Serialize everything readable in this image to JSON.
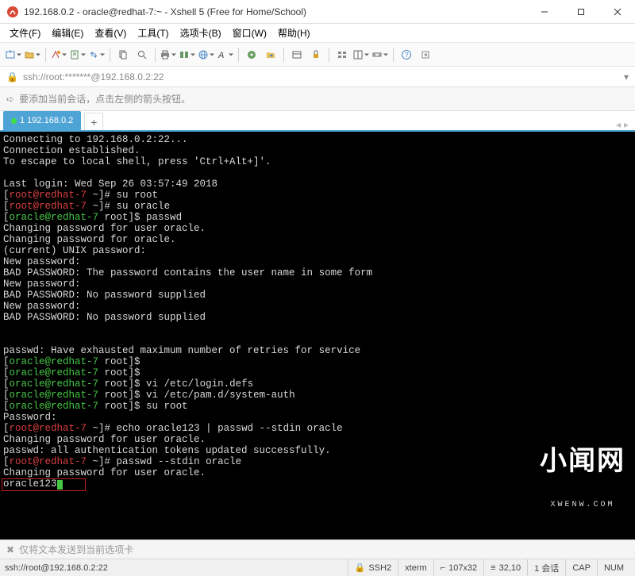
{
  "window": {
    "title": "192.168.0.2 - oracle@redhat-7:~ - Xshell 5 (Free for Home/School)"
  },
  "menu": {
    "file": "文件(F)",
    "edit": "编辑(E)",
    "view": "查看(V)",
    "tools": "工具(T)",
    "tab": "选项卡(B)",
    "window": "窗口(W)",
    "help": "帮助(H)"
  },
  "address": {
    "url": "ssh://root:*******@192.168.0.2:22"
  },
  "infobar": {
    "text": "要添加当前会话，点击左侧的箭头按钮。"
  },
  "tabs": [
    {
      "label": "1 192.168.0.2"
    }
  ],
  "terminal": {
    "lines": [
      {
        "segs": [
          {
            "c": "w",
            "t": "Connecting to 192.168.0.2:22..."
          }
        ]
      },
      {
        "segs": [
          {
            "c": "w",
            "t": "Connection established."
          }
        ]
      },
      {
        "segs": [
          {
            "c": "w",
            "t": "To escape to local shell, press 'Ctrl+Alt+]'."
          }
        ]
      },
      {
        "segs": []
      },
      {
        "segs": [
          {
            "c": "w",
            "t": "Last login: Wed Sep 26 03:57:49 2018"
          }
        ]
      },
      {
        "segs": [
          {
            "c": "w",
            "t": "["
          },
          {
            "c": "r",
            "t": "root@redhat-7"
          },
          {
            "c": "w",
            "t": " ~]# su root"
          }
        ]
      },
      {
        "segs": [
          {
            "c": "w",
            "t": "["
          },
          {
            "c": "r",
            "t": "root@redhat-7"
          },
          {
            "c": "w",
            "t": " ~]# su oracle"
          }
        ]
      },
      {
        "segs": [
          {
            "c": "w",
            "t": "["
          },
          {
            "c": "g",
            "t": "oracle@redhat-7"
          },
          {
            "c": "w",
            "t": " root]$ passwd"
          }
        ]
      },
      {
        "segs": [
          {
            "c": "w",
            "t": "Changing password for user oracle."
          }
        ]
      },
      {
        "segs": [
          {
            "c": "w",
            "t": "Changing password for oracle."
          }
        ]
      },
      {
        "segs": [
          {
            "c": "w",
            "t": "(current) UNIX password:"
          }
        ]
      },
      {
        "segs": [
          {
            "c": "w",
            "t": "New password:"
          }
        ]
      },
      {
        "segs": [
          {
            "c": "w",
            "t": "BAD PASSWORD: The password contains the user name in some form"
          }
        ]
      },
      {
        "segs": [
          {
            "c": "w",
            "t": "New password:"
          }
        ]
      },
      {
        "segs": [
          {
            "c": "w",
            "t": "BAD PASSWORD: No password supplied"
          }
        ]
      },
      {
        "segs": [
          {
            "c": "w",
            "t": "New password:"
          }
        ]
      },
      {
        "segs": [
          {
            "c": "w",
            "t": "BAD PASSWORD: No password supplied"
          }
        ]
      },
      {
        "segs": []
      },
      {
        "segs": []
      },
      {
        "segs": [
          {
            "c": "w",
            "t": "passwd: Have exhausted maximum number of retries for service"
          }
        ]
      },
      {
        "segs": [
          {
            "c": "w",
            "t": "["
          },
          {
            "c": "g",
            "t": "oracle@redhat-7"
          },
          {
            "c": "w",
            "t": " root]$"
          }
        ]
      },
      {
        "segs": [
          {
            "c": "w",
            "t": "["
          },
          {
            "c": "g",
            "t": "oracle@redhat-7"
          },
          {
            "c": "w",
            "t": " root]$"
          }
        ]
      },
      {
        "segs": [
          {
            "c": "w",
            "t": "["
          },
          {
            "c": "g",
            "t": "oracle@redhat-7"
          },
          {
            "c": "w",
            "t": " root]$ vi /etc/login.defs"
          }
        ]
      },
      {
        "segs": [
          {
            "c": "w",
            "t": "["
          },
          {
            "c": "g",
            "t": "oracle@redhat-7"
          },
          {
            "c": "w",
            "t": " root]$ vi /etc/pam.d/system-auth"
          }
        ]
      },
      {
        "segs": [
          {
            "c": "w",
            "t": "["
          },
          {
            "c": "g",
            "t": "oracle@redhat-7"
          },
          {
            "c": "w",
            "t": " root]$ su root"
          }
        ]
      },
      {
        "segs": [
          {
            "c": "w",
            "t": "Password:"
          }
        ]
      },
      {
        "segs": [
          {
            "c": "w",
            "t": "["
          },
          {
            "c": "r",
            "t": "root@redhat-7"
          },
          {
            "c": "w",
            "t": " ~]# echo oracle123 | passwd --stdin oracle"
          }
        ]
      },
      {
        "segs": [
          {
            "c": "w",
            "t": "Changing password for user oracle."
          }
        ]
      },
      {
        "segs": [
          {
            "c": "w",
            "t": "passwd: all authentication tokens updated successfully."
          }
        ]
      },
      {
        "segs": [
          {
            "c": "w",
            "t": "["
          },
          {
            "c": "r",
            "t": "root@redhat-7"
          },
          {
            "c": "w",
            "t": " ~]# passwd --stdin oracle"
          }
        ]
      },
      {
        "segs": [
          {
            "c": "w",
            "t": "Changing password for user oracle."
          }
        ]
      },
      {
        "segs": [
          {
            "c": "w",
            "t": "oracle123"
          }
        ],
        "cursor": true
      }
    ]
  },
  "watermark": {
    "big": "小闻网",
    "small": "XWENW.COM"
  },
  "bottominfo": {
    "text": "仅将文本发送到当前选项卡"
  },
  "status": {
    "left": "ssh://root@192.168.0.2:22",
    "protocol": "SSH2",
    "term": "xterm",
    "size": "107x32",
    "pos": "32,10",
    "session": "1 会话",
    "cap": "CAP",
    "num": "NUM"
  }
}
